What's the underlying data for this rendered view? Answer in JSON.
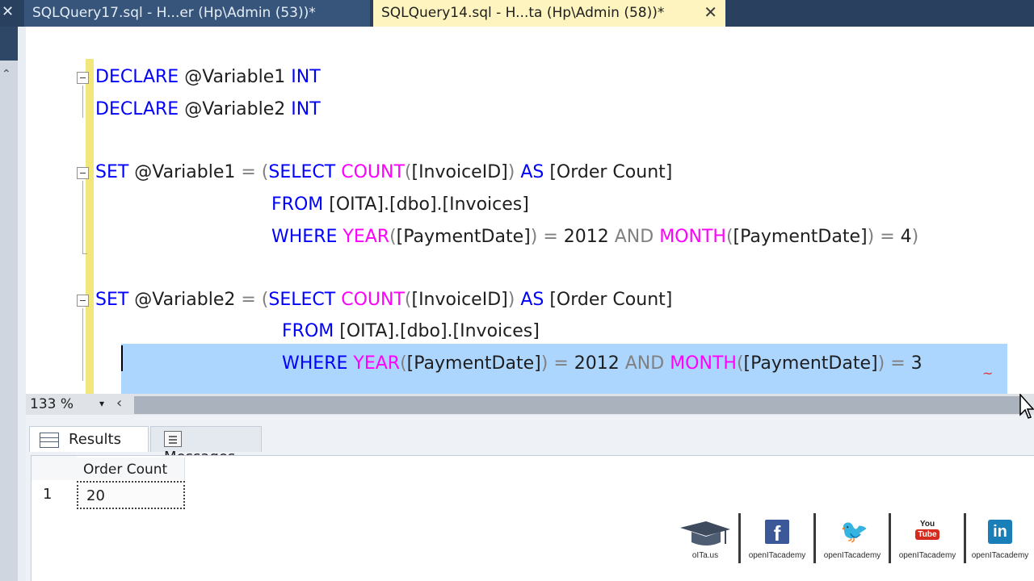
{
  "tabs": {
    "close_left": "✕",
    "inactive_label": "SQLQuery17.sql - H...er (Hp\\Admin (53))*",
    "active_label": "SQLQuery14.sql - H...ta (Hp\\Admin (58))*",
    "close_glyph": "✕"
  },
  "editor": {
    "line1": {
      "kw1": "DECLARE",
      "var": " @Variable1 ",
      "kw2": "INT"
    },
    "line2": {
      "kw1": "DECLARE",
      "var": " @Variable2 ",
      "kw2": "INT"
    },
    "set1": {
      "set_kw": "SET",
      "var": " @Variable1 ",
      "eq": "=",
      "paren": " (",
      "select_kw": "SELECT",
      "count_fn": " COUNT",
      "open": "(",
      "col": "[InvoiceID]",
      "close": ")",
      "as_kw": " AS",
      "alias": " [Order Count]",
      "from_kw": "FROM",
      "table": " [OITA].[dbo].[Invoices]",
      "where_kw": "WHERE",
      "year_fn": " YEAR",
      "p1": "(",
      "date_col": "[PaymentDate]",
      "p2": ")",
      "eq2": " = ",
      "year_val": "2012",
      "and_kw": " AND",
      "month_fn": " MONTH",
      "p3": "(",
      "date_col2": "[PaymentDate]",
      "p4": ")",
      "eq3": " = ",
      "month_val": "4",
      "p5": ")"
    },
    "set2": {
      "set_kw": "SET",
      "var": " @Variable2 ",
      "eq": "=",
      "paren": " (",
      "select_kw": "SELECT",
      "count_fn": " COUNT",
      "open": "(",
      "col": "[InvoiceID]",
      "close": ")",
      "as_kw": " AS",
      "alias": " [Order Count]",
      "from_kw": "FROM",
      "table": " [OITA].[dbo].[Invoices]",
      "where_kw": "WHERE",
      "year_fn": " YEAR",
      "p1": "(",
      "date_col": "[PaymentDate]",
      "p2": ")",
      "eq2": " = ",
      "year_val": "2012",
      "and_kw": " AND",
      "month_fn": " MONTH",
      "p3": "(",
      "date_col2": "[PaymentDate]",
      "p4": ")",
      "eq3": " = ",
      "month_val": "3"
    }
  },
  "scrollbar": {
    "zoom": "133 %",
    "zoom_caret": "▾",
    "left_arrow": "‹"
  },
  "results_tabs": {
    "results": "Results",
    "messages": "Messages"
  },
  "grid": {
    "column": "Order Count",
    "row_number": "1",
    "value": "20"
  },
  "social": {
    "brand": "oITa.us",
    "facebook": "openITacademy",
    "twitter": "openITacademy",
    "youtube": "openITacademy",
    "linkedin": "openITacademy",
    "fb_glyph": "f",
    "tw_glyph": "🐦",
    "yt_top": "You",
    "yt_bottom": "Tube",
    "in_glyph": "in"
  },
  "colors": {
    "keyword": "#0000ff",
    "function": "#ff00ff",
    "operator": "#808080",
    "selection": "#add6ff",
    "active_tab": "#fdf4bf"
  }
}
